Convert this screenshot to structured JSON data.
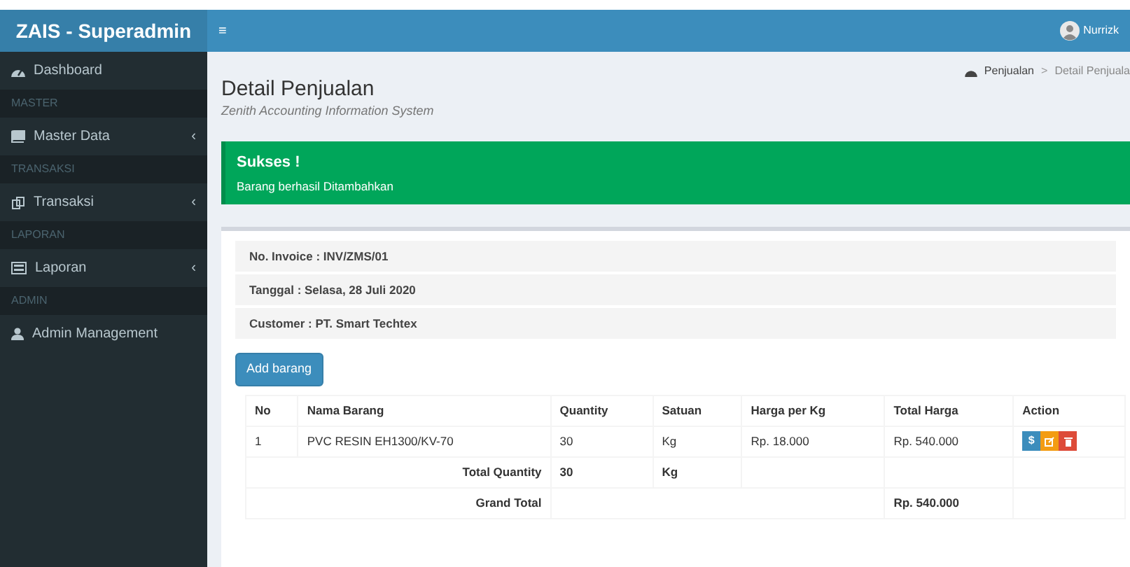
{
  "brand": "ZAIS - Superadmin",
  "menu_toggle": "≡",
  "user": {
    "name": "Nurrizk"
  },
  "sidebar": [
    {
      "kind": "item",
      "label": "Dashboard"
    },
    {
      "kind": "header",
      "label": "MASTER"
    },
    {
      "kind": "item",
      "label": "Master Data",
      "chevron": "‹"
    },
    {
      "kind": "header",
      "label": "TRANSAKSI"
    },
    {
      "kind": "item",
      "label": "Transaksi",
      "chevron": "‹"
    },
    {
      "kind": "header",
      "label": "LAPORAN"
    },
    {
      "kind": "item",
      "label": "Laporan",
      "chevron": "‹"
    },
    {
      "kind": "header",
      "label": "ADMIN"
    },
    {
      "kind": "item",
      "label": "Admin Management"
    }
  ],
  "breadcrumb": {
    "items": [
      "Penjualan",
      "Detail Penjuala"
    ],
    "separator": ">"
  },
  "page": {
    "title": "Detail Penjualan",
    "subtitle": "Zenith Accounting Information System"
  },
  "alert": {
    "title": "Sukses !",
    "message": "Barang berhasil Ditambahkan"
  },
  "info": [
    "No. Invoice : INV/ZMS/01",
    "Tanggal : Selasa, 28 Juli 2020",
    "Customer : PT. Smart Techtex"
  ],
  "add_button": "Add barang",
  "table": {
    "columns": [
      "No",
      "Nama Barang",
      "Quantity",
      "Satuan",
      "Harga per Kg",
      "Total Harga",
      "Action"
    ],
    "rows": [
      {
        "cells": [
          "1",
          "PVC RESIN EH1300/KV-70",
          "30",
          "Kg",
          "Rp. 18.000",
          "Rp. 540.000"
        ],
        "actions": [
          {
            "kind": "payment",
            "label": "$"
          },
          {
            "kind": "edit"
          },
          {
            "kind": "delete"
          }
        ]
      }
    ],
    "total_quantity": {
      "label": "Total Quantity",
      "value": "30",
      "unit": "Kg"
    },
    "grand_total": {
      "label": "Grand Total",
      "value": "Rp. 540.000"
    }
  }
}
